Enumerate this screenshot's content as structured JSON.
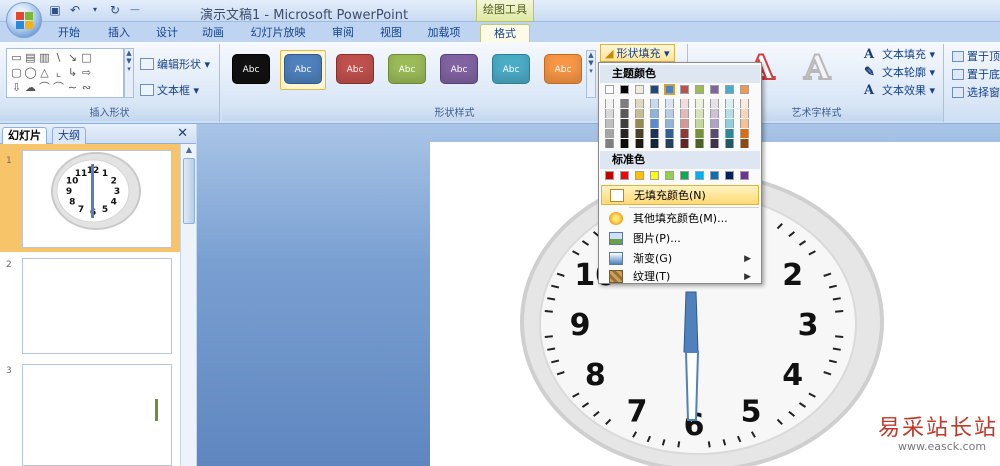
{
  "window": {
    "title": "演示文稿1 - Microsoft PowerPoint",
    "context_tool": "绘图工具"
  },
  "tabs": [
    {
      "label": "开始"
    },
    {
      "label": "插入"
    },
    {
      "label": "设计"
    },
    {
      "label": "动画"
    },
    {
      "label": "幻灯片放映"
    },
    {
      "label": "审阅"
    },
    {
      "label": "视图"
    },
    {
      "label": "加载项"
    },
    {
      "label": "格式",
      "active": true
    }
  ],
  "ribbon": {
    "insert_shapes": {
      "label": "插入形状",
      "edit_shape": "编辑形状 ▾",
      "text_box": "文本框 ▾"
    },
    "shape_styles": {
      "label": "形状样式",
      "style_preview_text": "Abc",
      "fill_button": "形状填充 ▾",
      "styles": [
        {
          "color": "#111111",
          "border": "#000000"
        },
        {
          "color": "#4f81bd",
          "border": "#2a5a94",
          "selected": true
        },
        {
          "color": "#c0504d",
          "border": "#8c2c2a"
        },
        {
          "color": "#9bbb59",
          "border": "#6d8a31"
        },
        {
          "color": "#8064a2",
          "border": "#583f79"
        },
        {
          "color": "#4bacc6",
          "border": "#2a7f96"
        },
        {
          "color": "#f79646",
          "border": "#c46a1f"
        }
      ]
    },
    "wordart_styles": {
      "label": "艺术字样式",
      "text_fill": "文本填充 ▾",
      "text_outline": "文本轮廓 ▾",
      "text_effects": "文本效果 ▾"
    },
    "arrange": {
      "bring_front": "置于顶",
      "send_back": "置于底",
      "selection_pane": "选择窗"
    }
  },
  "left_pane": {
    "tab_slides": "幻灯片",
    "tab_outline": "大纲",
    "slides": [
      {
        "number": "1",
        "selected": true
      },
      {
        "number": "2"
      },
      {
        "number": "3"
      }
    ]
  },
  "clock": {
    "numbers": [
      "12",
      "1",
      "2",
      "3",
      "4",
      "5",
      "6",
      "7",
      "8",
      "9",
      "10",
      "11"
    ]
  },
  "fill_menu": {
    "theme_colors_label": "主题颜色",
    "standard_colors_label": "标准色",
    "theme_top_row": [
      "#ffffff",
      "#000000",
      "#eeece1",
      "#1f497d",
      "#4f81bd",
      "#c0504d",
      "#9bbb59",
      "#8064a2",
      "#4bacc6",
      "#f79646"
    ],
    "theme_shades": [
      [
        "#f2f2f2",
        "#7f7f7f",
        "#ddd9c3",
        "#c6d9f0",
        "#dbe5f1",
        "#f2dcdb",
        "#ebf1dd",
        "#e5e0ec",
        "#dbeef3",
        "#fdeada"
      ],
      [
        "#d8d8d8",
        "#595959",
        "#c4bd97",
        "#8db3e2",
        "#b8cce4",
        "#e5b9b7",
        "#d7e3bc",
        "#ccc1d9",
        "#b7dde8",
        "#fbd5b5"
      ],
      [
        "#bfbfbf",
        "#3f3f3f",
        "#938953",
        "#548dd4",
        "#95b3d7",
        "#d99694",
        "#c3d69b",
        "#b2a2c7",
        "#92cddc",
        "#fac08f"
      ],
      [
        "#a5a5a5",
        "#262626",
        "#494429",
        "#17365d",
        "#366092",
        "#953734",
        "#76923c",
        "#5f497a",
        "#31859b",
        "#e36c09"
      ],
      [
        "#7f7f7f",
        "#0c0c0c",
        "#1d1b10",
        "#0f243e",
        "#244061",
        "#632423",
        "#4f6128",
        "#3f3151",
        "#205867",
        "#974806"
      ]
    ],
    "standard_colors": [
      "#c00000",
      "#ff0000",
      "#ffc000",
      "#ffff00",
      "#92d050",
      "#00b050",
      "#00b0f0",
      "#0070c0",
      "#002060",
      "#7030a0"
    ],
    "items": [
      {
        "label": "无填充颜色(N)",
        "highlighted": true
      },
      {
        "label": "其他填充颜色(M)..."
      },
      {
        "label": "图片(P)..."
      },
      {
        "label": "渐变(G)",
        "submenu": true
      },
      {
        "label": "纹理(T)",
        "submenu": true
      }
    ]
  },
  "watermark": {
    "text": "易采站长站",
    "url": "www.easck.com"
  }
}
